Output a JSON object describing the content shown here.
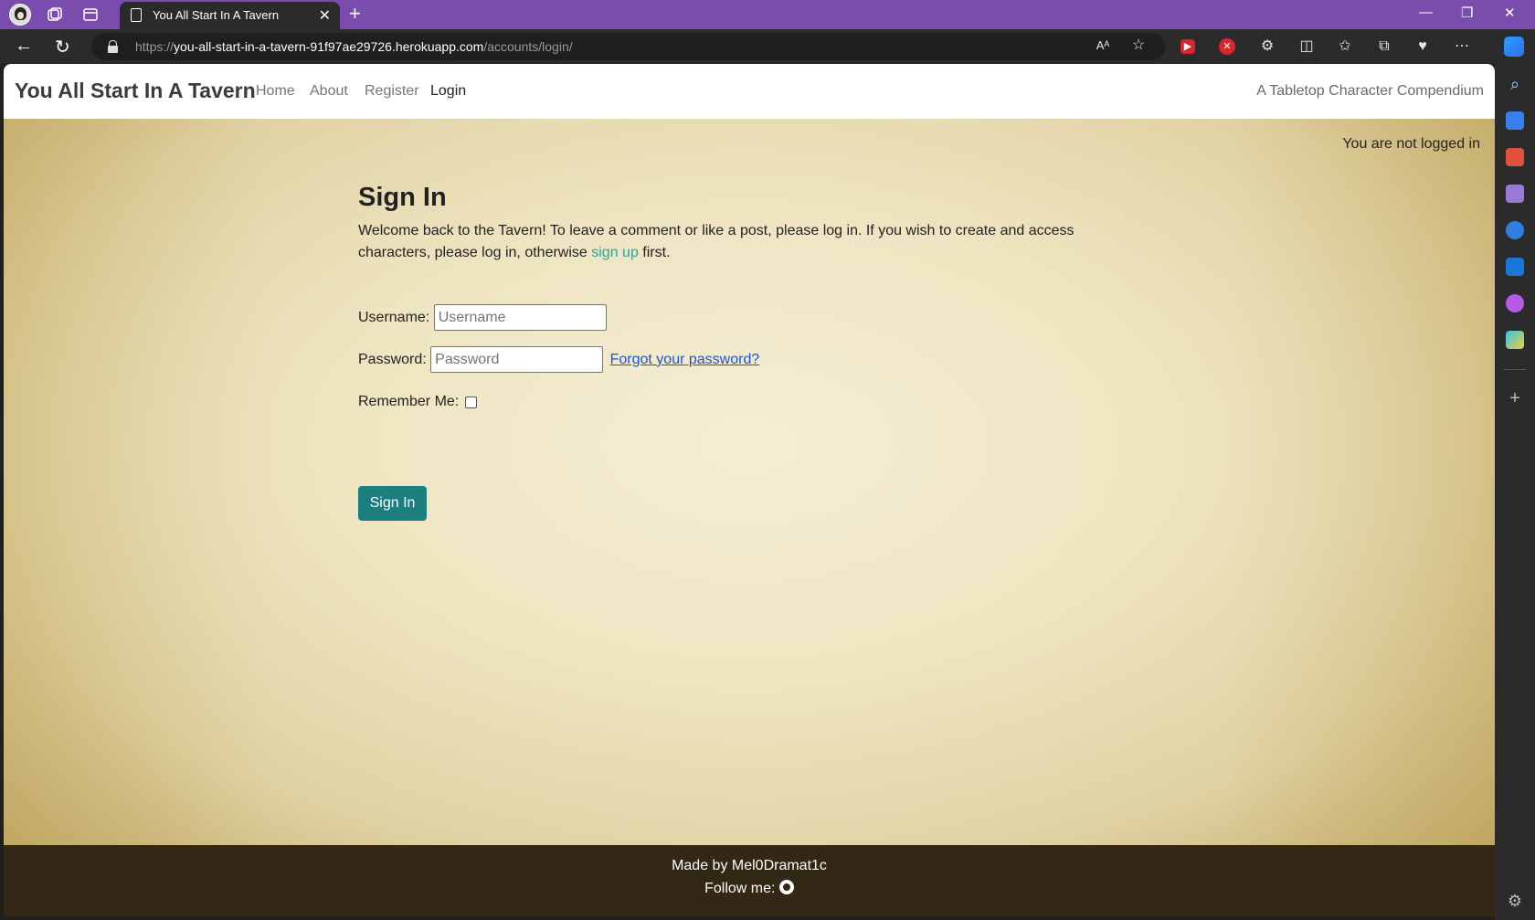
{
  "browser": {
    "tab_title": "You All Start In A Tavern",
    "tab_close": "✕",
    "new_tab": "+",
    "url_scheme": "https://",
    "url_host": "you-all-start-in-a-tavern-91f97ae29726.herokuapp.com",
    "url_path": "/accounts/login/",
    "window_controls": {
      "minimize": "—",
      "restore": "❐",
      "close": "✕"
    },
    "nav": {
      "back": "←",
      "refresh": "↻"
    },
    "toolbar_icons": [
      "read-aloud-icon",
      "favorite-star-icon",
      "extension-red-icon",
      "extension-block-icon",
      "extensions-icon",
      "split-screen-icon",
      "favorites-icon",
      "collections-icon",
      "performance-icon",
      "more-icon",
      "copilot-icon"
    ],
    "sidebar_icons": [
      "search-icon",
      "shopping-icon",
      "tools-icon",
      "games-icon",
      "bing-icon",
      "outlook-icon",
      "designer-icon",
      "drop-icon",
      "add-icon",
      "settings-icon"
    ]
  },
  "site": {
    "brand": "You All Start In A Tavern",
    "nav": [
      {
        "label": "Home"
      },
      {
        "label": "About"
      },
      {
        "label": "Register"
      },
      {
        "label": "Login"
      }
    ],
    "tagline": "A Tabletop Character Compendium",
    "status": "You are not logged in"
  },
  "signin": {
    "heading": "Sign In",
    "intro_before": "Welcome back to the Tavern! To leave a comment or like a post, please log in. If you wish to create and access characters, please log in, otherwise ",
    "intro_link": "sign up",
    "intro_after": " first.",
    "username_label": "Username:",
    "username_placeholder": "Username",
    "password_label": "Password:",
    "password_placeholder": "Password",
    "forgot_link": "Forgot your password?",
    "remember_label": "Remember Me:",
    "remember_checked": false,
    "submit_label": "Sign In"
  },
  "footer": {
    "made_by": "Made by Mel0Dramat1c",
    "follow": "Follow me:"
  },
  "colors": {
    "browser_tabbar": "#7a4cae",
    "button_teal": "#1b7f7f",
    "link_teal": "#2aa4a4",
    "footer_bg": "#332716"
  }
}
